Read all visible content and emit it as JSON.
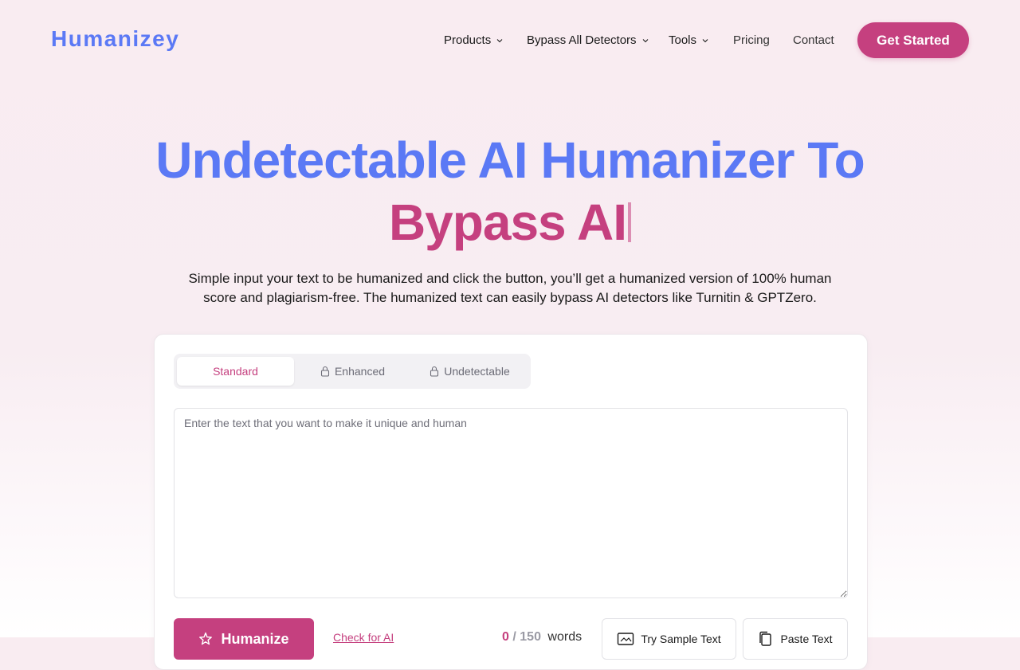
{
  "colors": {
    "primary_blue": "#5b79f5",
    "accent_pink": "#c5407f",
    "text_dark": "#1a1a1a"
  },
  "header": {
    "logo": "Humanizey",
    "nav": [
      {
        "label": "Products",
        "has_dropdown": true
      },
      {
        "label": "Bypass All Detectors",
        "has_dropdown": true
      },
      {
        "label": "Tools",
        "has_dropdown": true
      },
      {
        "label": "Pricing",
        "has_dropdown": false
      },
      {
        "label": "Contact",
        "has_dropdown": false
      }
    ],
    "cta_label": "Get Started"
  },
  "hero": {
    "title_line1": "Undetectable AI Humanizer To",
    "title_line2": "Bypass AI",
    "subtitle": "Simple input your text to be humanized and click the button, you’ll get a humanized version of 100% human score and plagiarism-free. The humanized text can easily bypass AI detectors like Turnitin & GPTZero."
  },
  "editor": {
    "tabs": [
      {
        "label": "Standard",
        "active": true,
        "locked": false,
        "icon": null
      },
      {
        "label": "Enhanced",
        "active": false,
        "locked": true,
        "icon": "lock-icon"
      },
      {
        "label": "Undetectable",
        "active": false,
        "locked": true,
        "icon": "lock-icon"
      }
    ],
    "placeholder": "Enter the text that you want to make it unique and human",
    "value": "",
    "humanize_label": "Humanize",
    "check_label": "Check for AI",
    "word_count": "0",
    "word_sep": "/",
    "word_limit": "150",
    "word_unit": "words",
    "sample_label": "Try Sample Text",
    "paste_label": "Paste Text"
  }
}
